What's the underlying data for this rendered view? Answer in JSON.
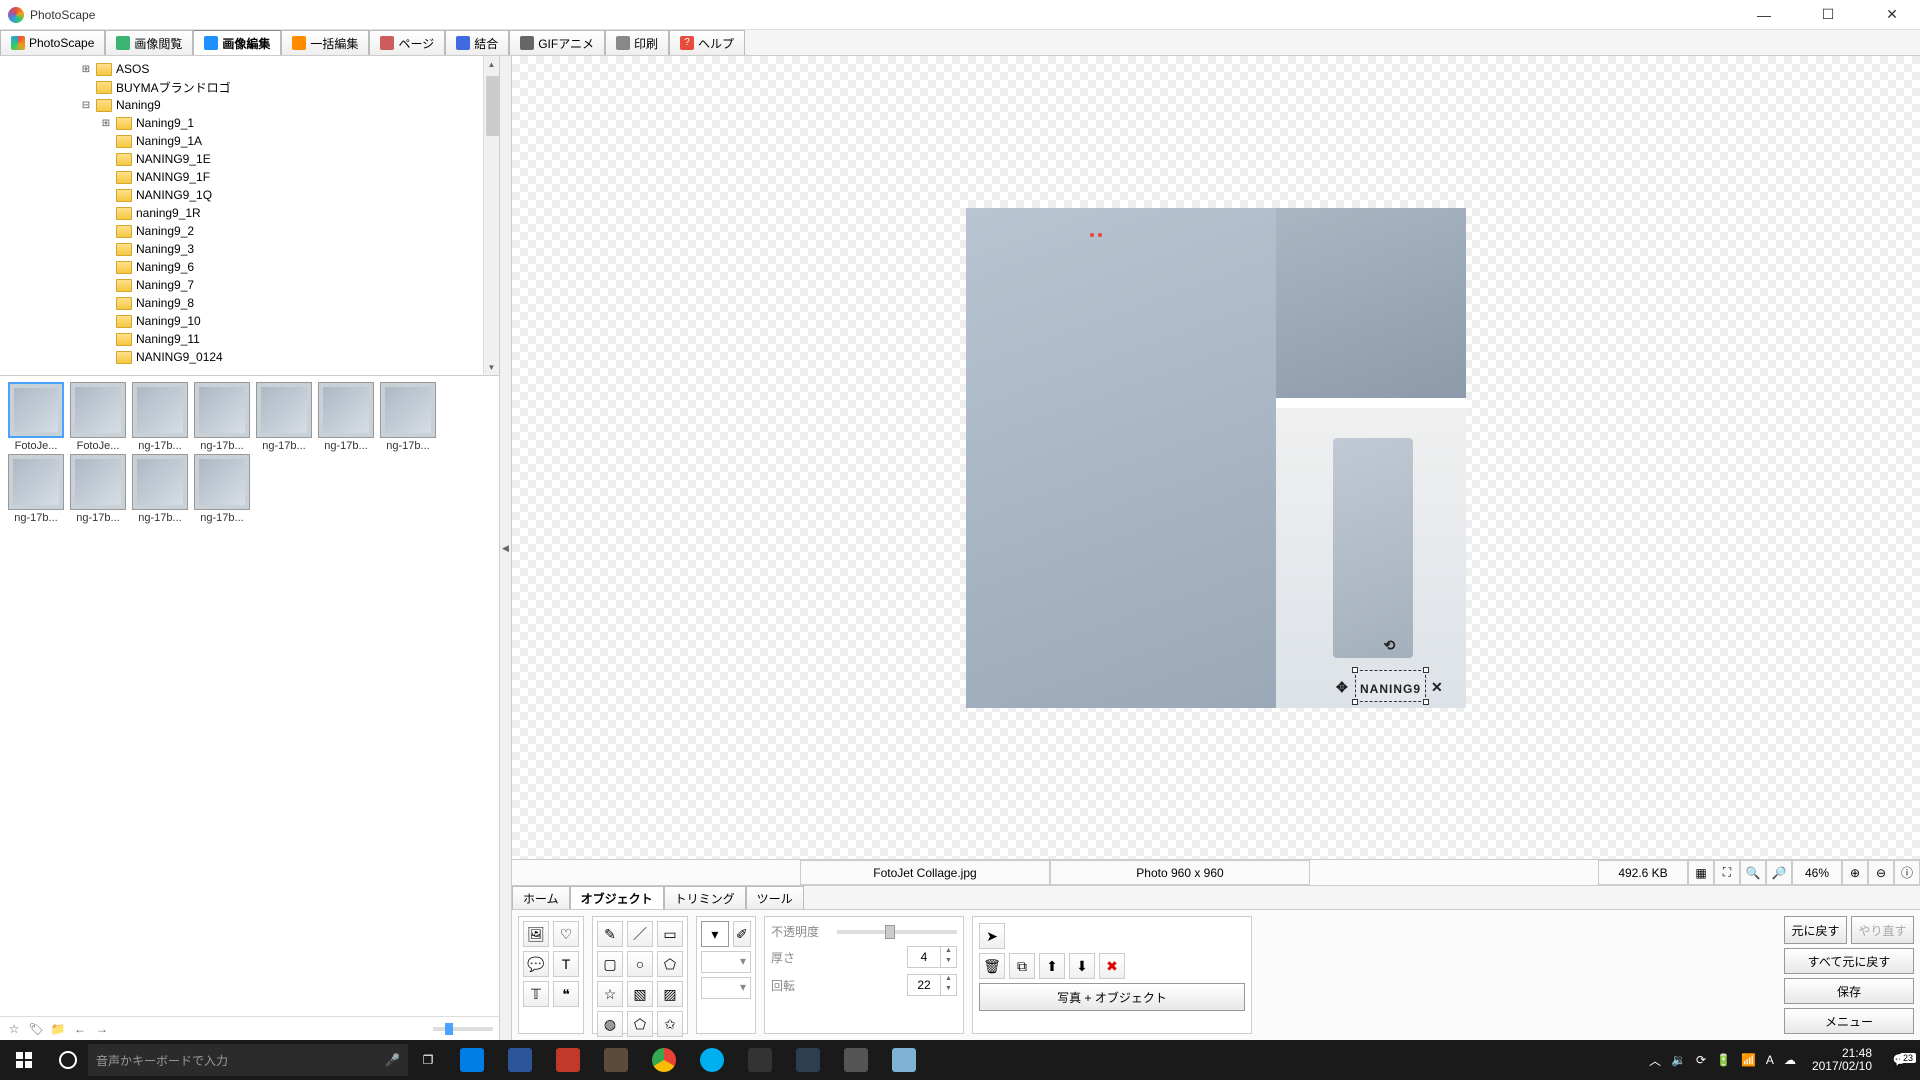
{
  "window": {
    "title": "PhotoScape"
  },
  "maintabs": [
    {
      "label": "PhotoScape",
      "icon": "ps"
    },
    {
      "label": "画像閲覧",
      "icon": "view"
    },
    {
      "label": "画像編集",
      "icon": "edit",
      "active": true
    },
    {
      "label": "一括編集",
      "icon": "batch"
    },
    {
      "label": "ページ",
      "icon": "page"
    },
    {
      "label": "結合",
      "icon": "combine"
    },
    {
      "label": "GIFアニメ",
      "icon": "gif"
    },
    {
      "label": "印刷",
      "icon": "print"
    },
    {
      "label": "ヘルプ",
      "icon": "help"
    }
  ],
  "tree": [
    {
      "indent": 80,
      "exp": "⊞",
      "label": "ASOS"
    },
    {
      "indent": 80,
      "exp": "",
      "label": "BUYMAブランドロゴ"
    },
    {
      "indent": 80,
      "exp": "⊟",
      "label": "Naning9"
    },
    {
      "indent": 100,
      "exp": "⊞",
      "label": "Naning9_1"
    },
    {
      "indent": 100,
      "exp": "",
      "label": "Naning9_1A"
    },
    {
      "indent": 100,
      "exp": "",
      "label": "NANING9_1E"
    },
    {
      "indent": 100,
      "exp": "",
      "label": "NANING9_1F"
    },
    {
      "indent": 100,
      "exp": "",
      "label": "NANING9_1Q"
    },
    {
      "indent": 100,
      "exp": "",
      "label": "naning9_1R"
    },
    {
      "indent": 100,
      "exp": "",
      "label": "Naning9_2"
    },
    {
      "indent": 100,
      "exp": "",
      "label": "Naning9_3"
    },
    {
      "indent": 100,
      "exp": "",
      "label": "Naning9_6"
    },
    {
      "indent": 100,
      "exp": "",
      "label": "Naning9_7"
    },
    {
      "indent": 100,
      "exp": "",
      "label": "Naning9_8"
    },
    {
      "indent": 100,
      "exp": "",
      "label": "Naning9_10"
    },
    {
      "indent": 100,
      "exp": "",
      "label": "Naning9_11"
    },
    {
      "indent": 100,
      "exp": "",
      "label": "NANING9_0124"
    }
  ],
  "thumbs": [
    {
      "label": "FotoJe...",
      "sel": true
    },
    {
      "label": "FotoJe..."
    },
    {
      "label": "ng-17b..."
    },
    {
      "label": "ng-17b..."
    },
    {
      "label": "ng-17b..."
    },
    {
      "label": "ng-17b..."
    },
    {
      "label": "ng-17b..."
    },
    {
      "label": "ng-17b..."
    },
    {
      "label": "ng-17b..."
    },
    {
      "label": "ng-17b..."
    },
    {
      "label": "ng-17b..."
    }
  ],
  "canvas": {
    "text_overlay": "NANING9"
  },
  "status": {
    "filename": "FotoJet Collage.jpg",
    "dimensions": "Photo 960 x 960",
    "filesize": "492.6 KB",
    "zoom": "46%"
  },
  "edittabs": [
    {
      "label": "ホーム"
    },
    {
      "label": "オブジェクト",
      "active": true
    },
    {
      "label": "トリミング"
    },
    {
      "label": "ツール"
    }
  ],
  "props": {
    "opacity_label": "不透明度",
    "thickness_label": "厚さ",
    "thickness_value": "4",
    "rotation_label": "回転",
    "rotation_value": "22"
  },
  "photo_object_btn": "写真 + オブジェクト",
  "rightbtns": {
    "undo": "元に戻す",
    "redo": "やり直す",
    "undo_all": "すべて元に戻す",
    "save": "保存",
    "menu": "メニュー"
  },
  "taskbar": {
    "search_placeholder": "音声かキーボードで入力",
    "apps": [
      {
        "name": "dropbox",
        "color": "#007ee5"
      },
      {
        "name": "word",
        "color": "#2b579a"
      },
      {
        "name": "grc",
        "color": "#c0392b"
      },
      {
        "name": "gimp",
        "color": "#5c4b3b"
      },
      {
        "name": "chrome",
        "color": "#fff"
      },
      {
        "name": "skype",
        "color": "#00aff0"
      },
      {
        "name": "photoscape",
        "color": "#333"
      },
      {
        "name": "sirius",
        "color": "#2c3e50"
      },
      {
        "name": "app1",
        "color": "#555"
      },
      {
        "name": "app2",
        "color": "#7fb3d5"
      }
    ],
    "time": "21:48",
    "date": "2017/02/10",
    "notif_count": "23"
  }
}
